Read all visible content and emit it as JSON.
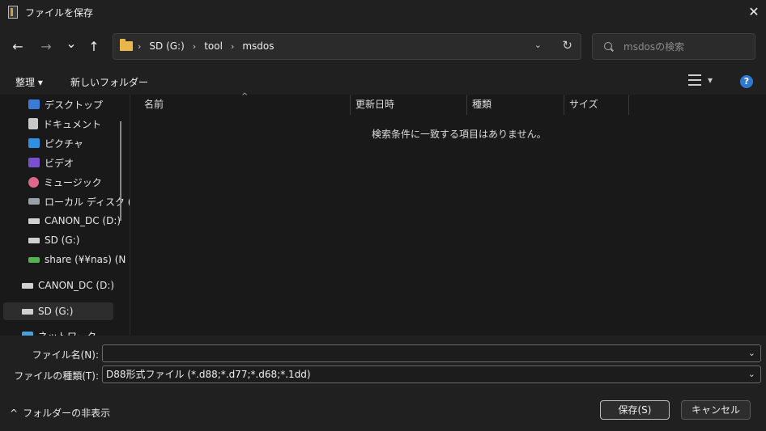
{
  "window": {
    "title": "ファイルを保存",
    "close_glyph": "✕"
  },
  "nav": {
    "back_glyph": "←",
    "forward_glyph": "→",
    "recent_glyph": "⌄",
    "up_glyph": "↑"
  },
  "address": {
    "crumbs": [
      "SD (G:)",
      "tool",
      "msdos"
    ],
    "separator": "›",
    "dropdown_glyph": "⌄",
    "refresh_glyph": "↻"
  },
  "search": {
    "placeholder": "msdosの検索"
  },
  "toolbar": {
    "organize_label": "整理 ▾",
    "new_folder_label": "新しいフォルダー",
    "view_dropdown_glyph": "▾",
    "help_glyph": "?"
  },
  "sidebar": {
    "items": [
      {
        "label": "デスクトップ",
        "icon": "desktop-icon"
      },
      {
        "label": "ドキュメント",
        "icon": "documents-icon"
      },
      {
        "label": "ピクチャ",
        "icon": "pictures-icon"
      },
      {
        "label": "ビデオ",
        "icon": "videos-icon"
      },
      {
        "label": "ミュージック",
        "icon": "music-icon"
      },
      {
        "label": "ローカル ディスク (C",
        "icon": "local-disk-icon"
      },
      {
        "label": "CANON_DC (D:)",
        "icon": "drive-icon"
      },
      {
        "label": "SD (G:)",
        "icon": "drive-icon"
      },
      {
        "label": "share (¥¥nas) (N",
        "icon": "network-drive-icon"
      },
      {
        "label": "CANON_DC (D:)",
        "icon": "drive-icon"
      },
      {
        "label": "SD (G:)",
        "icon": "drive-icon",
        "selected": true
      },
      {
        "label": "ネットワーク",
        "icon": "network-icon"
      }
    ]
  },
  "file_list": {
    "columns": [
      "名前",
      "更新日時",
      "種類",
      "サイズ"
    ],
    "sort_glyph": "^",
    "empty_message": "検索条件に一致する項目はありません。"
  },
  "save_form": {
    "filename_label": "ファイル名(N):",
    "filename_value": "",
    "filetype_label": "ファイルの種類(T):",
    "filetype_value": "D88形式ファイル (*.d88;*.d77;*.d68;*.1dd)",
    "dropdown_glyph": "⌄"
  },
  "footer": {
    "toggle_glyph": "^",
    "hide_folders_label": "フォルダーの非表示",
    "save_label": "保存(S)",
    "cancel_label": "キャンセル"
  },
  "colors": {
    "accent": "#2f7ad1",
    "folder": "#e8b64a",
    "background": "#1c1c1c"
  }
}
